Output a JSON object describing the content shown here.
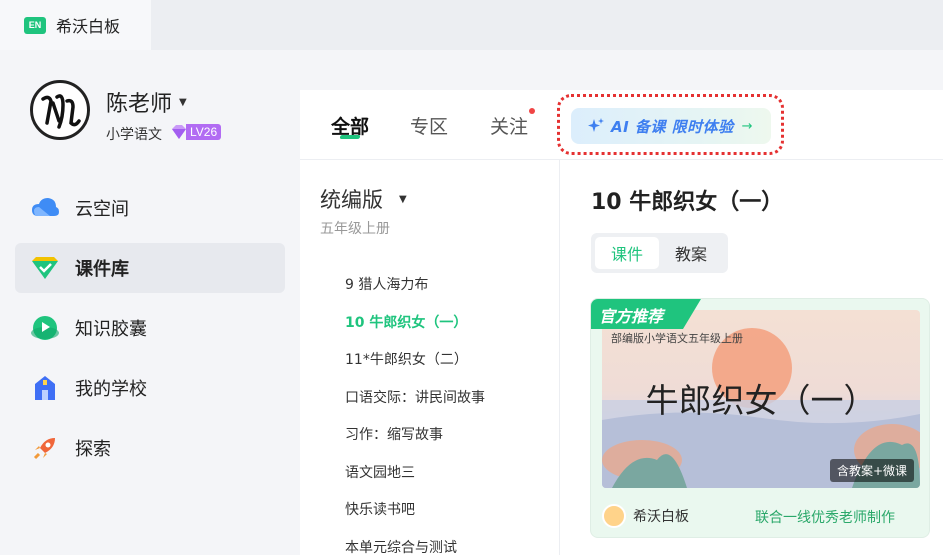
{
  "app": {
    "logo_text": "EN",
    "name": "希沃白板"
  },
  "user": {
    "name": "陈老师",
    "subject": "小学语文",
    "level": "LV26"
  },
  "nav": [
    {
      "label": "云空间",
      "icon": "cloud-icon"
    },
    {
      "label": "课件库",
      "icon": "courseware-icon",
      "active": true
    },
    {
      "label": "知识胶囊",
      "icon": "capsule-icon"
    },
    {
      "label": "我的学校",
      "icon": "school-icon"
    },
    {
      "label": "探索",
      "icon": "rocket-icon"
    }
  ],
  "tabs": {
    "all": "全部",
    "zone": "专区",
    "follow": "关注"
  },
  "ai_banner": {
    "text": "AI 备课 限时体验",
    "arrow": "→"
  },
  "chapters": {
    "edition": "统编版",
    "grade": "五年级上册",
    "lessons": [
      "9 猎人海力布",
      "10 牛郎织女（一）",
      "11*牛郎织女（二）",
      "口语交际：讲民间故事",
      "习作：缩写故事",
      "语文园地三",
      "快乐读书吧",
      "本单元综合与测试"
    ],
    "active_index": 1
  },
  "detail": {
    "title": "10 牛郎织女（一）",
    "segments": {
      "courseware": "课件",
      "lesson_plan": "教案"
    },
    "card": {
      "badge": "官方推荐",
      "series": "部编版小学语文五年级上册",
      "thumb_title": "牛郎织女（一）",
      "tag": "含教案+微课",
      "creator": "希沃白板",
      "creator_tag": "联合一线优秀老师制作"
    }
  },
  "colors": {
    "brand": "#1fc47e",
    "ai_blue": "#3e7ff0",
    "highlight_red": "#e53131",
    "level_purple": "#b26cf3"
  }
}
